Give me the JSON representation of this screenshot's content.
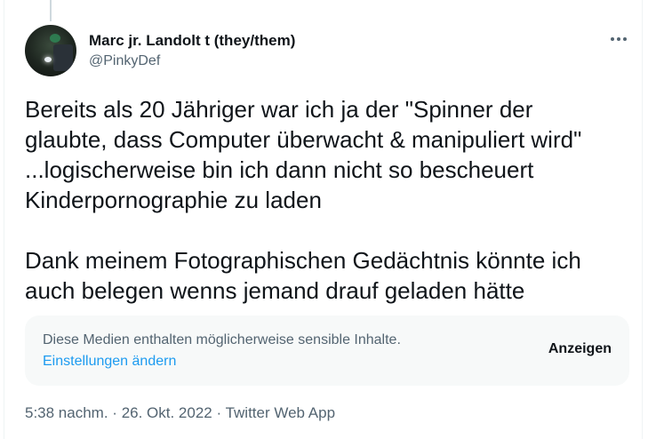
{
  "tweet": {
    "author": {
      "display_name": "Marc jr. Landolt t (they/them)",
      "handle": "@PinkyDef"
    },
    "text_lines": [
      "Bereits als 20 Jähriger war ich ja der \"Spinner der",
      "glaubte, dass Computer überwacht & manipuliert wird\"",
      "...logischerweise bin ich dann nicht so bescheuert",
      "Kinderpornographie zu laden",
      "Dank meinem Fotographischen Gedächtnis könnte ich",
      "auch belegen wenns jemand drauf geladen hätte"
    ],
    "sensitive_notice": {
      "message": "Diese Medien enthalten möglicherweise sensible Inhalte.",
      "settings_link": "Einstellungen ändern",
      "show_button": "Anzeigen"
    },
    "meta": {
      "time": "5:38 nachm.",
      "separator": "·",
      "date": "26. Okt. 2022",
      "source": "Twitter Web App"
    }
  },
  "icons": {
    "more": "more-horizontal-icon"
  },
  "colors": {
    "text_primary": "#0f1419",
    "text_secondary": "#536471",
    "link": "#1d9bf0",
    "notice_background": "#f7f9f9"
  }
}
